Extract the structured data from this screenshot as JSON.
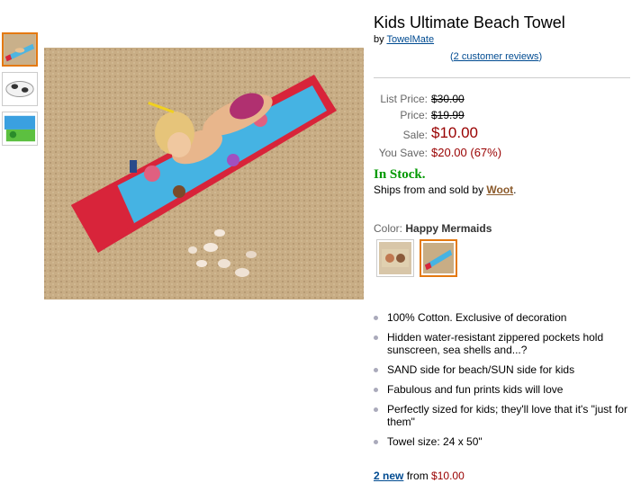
{
  "product": {
    "title": "Kids Ultimate Beach Towel",
    "by_prefix": "by",
    "brand": "TowelMate",
    "reviews_open": "(",
    "reviews_link": "2 customer reviews",
    "reviews_close": ")"
  },
  "pricing": {
    "list_label": "List Price:",
    "list_value": "$30.00",
    "price_label": "Price:",
    "price_value": "$19.99",
    "sale_label": "Sale:",
    "sale_value": "$10.00",
    "save_label": "You Save:",
    "save_value": "$20.00 (67%)"
  },
  "availability": {
    "status": "In Stock.",
    "ships_prefix": "Ships from and sold by",
    "seller": "Woot",
    "ships_suffix": "."
  },
  "color": {
    "label": "Color:",
    "selected": "Happy Mermaids"
  },
  "features": [
    "100% Cotton. Exclusive of decoration",
    "Hidden water-resistant zippered pockets hold sunscreen, sea shells and...?",
    "SAND side for beach/SUN side for kids",
    "Fabulous and fun prints kids will love",
    "Perfectly sized for kids; they'll love that it's \"just for them\"",
    "Towel size: 24 x 50\""
  ],
  "offers": {
    "new_link": "2 new",
    "from_text": "from",
    "from_price": "$10.00"
  },
  "colors": {
    "accent": "#e47911",
    "price_red": "#990000",
    "link_blue": "#004b91",
    "stock_green": "#009900"
  }
}
